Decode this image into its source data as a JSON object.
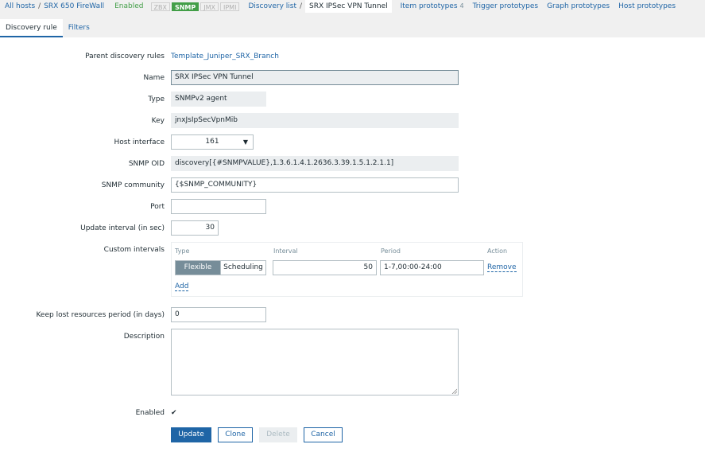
{
  "breadcrumb": {
    "all_hosts": "All hosts",
    "sep": "/",
    "host": "SRX 650 FireWall",
    "status": "Enabled",
    "badges": [
      "ZBX",
      "SNMP",
      "JMX",
      "IPMI"
    ],
    "discovery_list": "Discovery list",
    "current": "SRX IPSec VPN Tunnel",
    "item_prototypes": "Item prototypes",
    "item_prototypes_count": "4",
    "trigger_prototypes": "Trigger prototypes",
    "graph_prototypes": "Graph prototypes",
    "host_prototypes": "Host prototypes"
  },
  "tabs": [
    "Discovery rule",
    "Filters"
  ],
  "form": {
    "parent_label": "Parent discovery rules",
    "parent_value": "Template_Juniper_SRX_Branch",
    "name_label": "Name",
    "name_value": "SRX IPSec VPN Tunnel",
    "type_label": "Type",
    "type_value": "SNMPv2 agent",
    "key_label": "Key",
    "key_value": "jnxJsIpSecVpnMib",
    "interface_label": "Host interface",
    "interface_value": "161",
    "oid_label": "SNMP OID",
    "oid_value": "discovery[{#SNMPVALUE},1.3.6.1.4.1.2636.3.39.1.5.1.2.1.1]",
    "community_label": "SNMP community",
    "community_value": "{$SNMP_COMMUNITY}",
    "port_label": "Port",
    "port_value": "",
    "update_label": "Update interval (in sec)",
    "update_value": "30",
    "custom_label": "Custom intervals",
    "custom": {
      "col_type": "Type",
      "col_interval": "Interval",
      "col_period": "Period",
      "col_action": "Action",
      "flexible": "Flexible",
      "scheduling": "Scheduling",
      "interval_value": "50",
      "period_value": "1-7,00:00-24:00",
      "remove": "Remove",
      "add": "Add"
    },
    "keep_label": "Keep lost resources period (in days)",
    "keep_value": "0",
    "description_label": "Description",
    "enabled_label": "Enabled",
    "enabled_check": "✔"
  },
  "buttons": {
    "update": "Update",
    "clone": "Clone",
    "delete": "Delete",
    "cancel": "Cancel"
  },
  "colors": {
    "link": "#1f65a6",
    "enabled": "#429e47",
    "muted": "#768d99"
  }
}
